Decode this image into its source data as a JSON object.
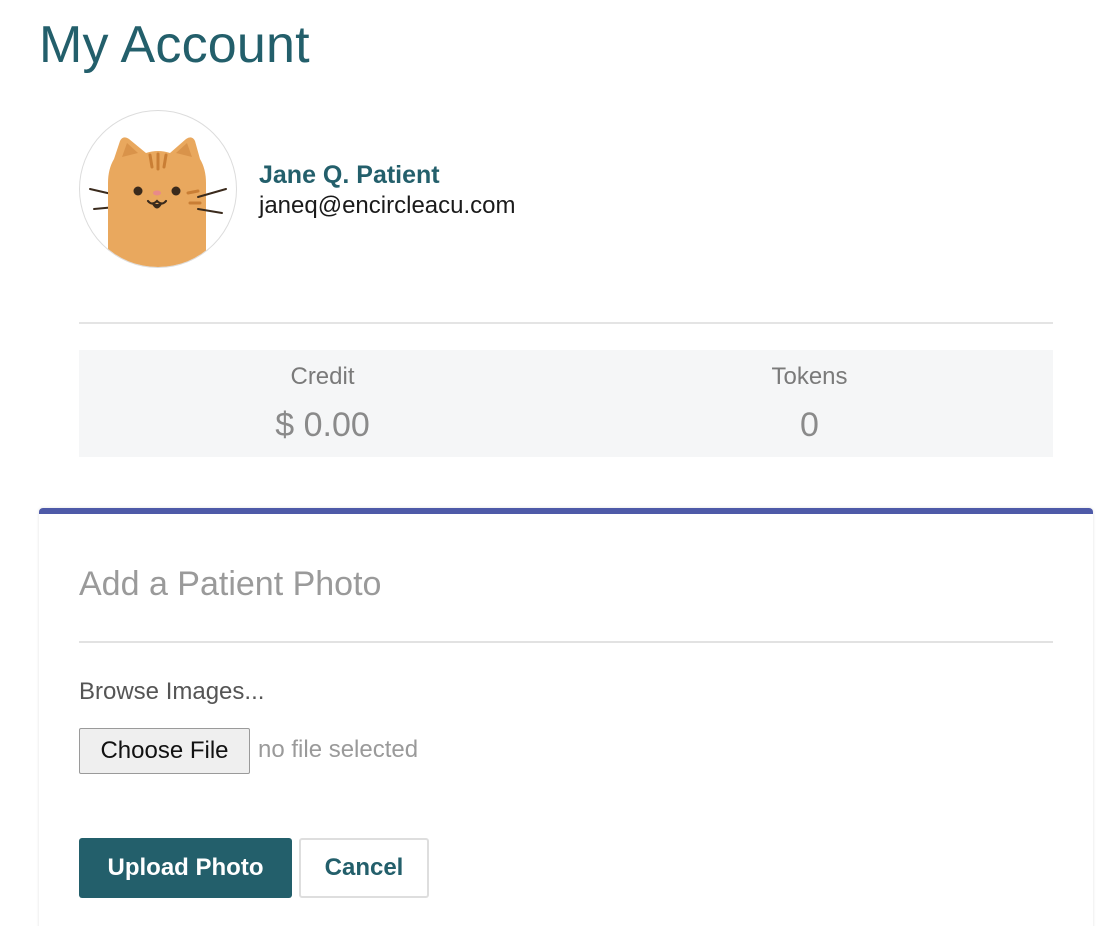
{
  "page": {
    "title": "My Account"
  },
  "profile": {
    "avatar_icon": "cat-avatar-icon",
    "name": "Jane Q. Patient",
    "email": "janeq@encircleacu.com"
  },
  "stats": {
    "credit_label": "Credit",
    "credit_value": "$ 0.00",
    "tokens_label": "Tokens",
    "tokens_value": "0"
  },
  "photo_panel": {
    "title": "Add a Patient Photo",
    "browse_label": "Browse Images...",
    "choose_file_label": "Choose File",
    "file_status": "no file selected",
    "upload_label": "Upload Photo",
    "cancel_label": "Cancel"
  },
  "colors": {
    "brand_teal": "#235f6b",
    "panel_accent": "#4e5aa8",
    "cat_fur": "#e9a85e"
  }
}
